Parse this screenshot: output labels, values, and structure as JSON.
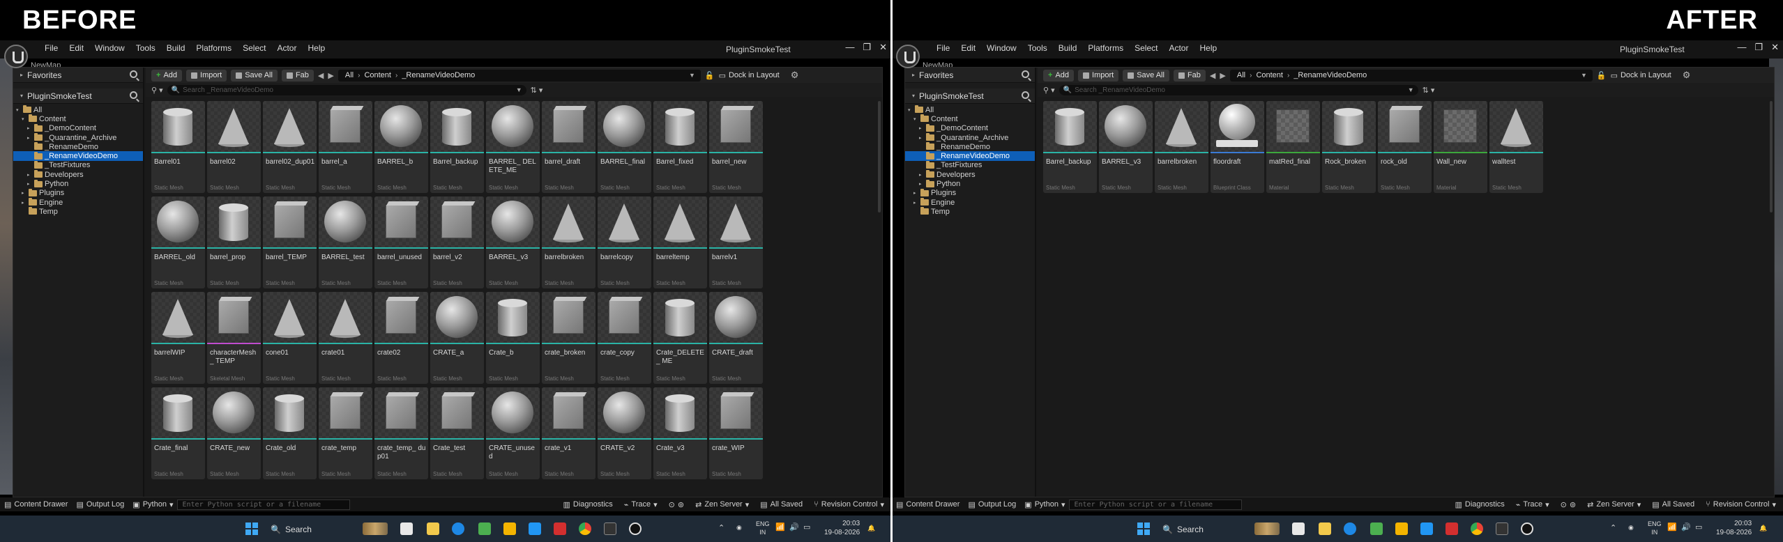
{
  "labels": {
    "before": "BEFORE",
    "after": "AFTER"
  },
  "app": {
    "title": "PluginSmokeTest",
    "menu": [
      "File",
      "Edit",
      "Window",
      "Tools",
      "Build",
      "Platforms",
      "Select",
      "Actor",
      "Help"
    ],
    "tab": "NewMap",
    "window_buttons": [
      "—",
      "❐",
      "✕"
    ]
  },
  "sidebar": {
    "favorites": "Favorites",
    "project": "PluginSmokeTest",
    "tree": [
      {
        "label": "All",
        "indent": 0,
        "arrow": "▾",
        "folder": true
      },
      {
        "label": "Content",
        "indent": 1,
        "arrow": "▾",
        "folder": true
      },
      {
        "label": "_DemoContent",
        "indent": 2,
        "arrow": "▸",
        "folder": true
      },
      {
        "label": "_Quarantine_Archive",
        "indent": 2,
        "arrow": "▸",
        "folder": true
      },
      {
        "label": "_RenameDemo",
        "indent": 2,
        "arrow": "",
        "folder": true
      },
      {
        "label": "_RenameVideoDemo",
        "indent": 2,
        "arrow": "",
        "folder": true,
        "selected": true
      },
      {
        "label": "_TestFixtures",
        "indent": 2,
        "arrow": "",
        "folder": true
      },
      {
        "label": "Developers",
        "indent": 2,
        "arrow": "▸",
        "folder": true
      },
      {
        "label": "Python",
        "indent": 2,
        "arrow": "▸",
        "folder": true
      },
      {
        "label": "Plugins",
        "indent": 1,
        "arrow": "▸",
        "folder": true
      },
      {
        "label": "Engine",
        "indent": 1,
        "arrow": "▸",
        "folder": true
      },
      {
        "label": "Temp",
        "indent": 1,
        "arrow": "",
        "folder": true
      }
    ]
  },
  "toolbar": {
    "add": "Add",
    "import": "Import",
    "save_all": "Save All",
    "fab": "Fab",
    "path": [
      "All",
      "Content",
      "_RenameVideoDemo"
    ],
    "dock": "Dock in Layout"
  },
  "search": {
    "placeholder": "Search _RenameVideoDemo"
  },
  "before_assets": [
    {
      "name": "Barrel01",
      "type": "Static Mesh",
      "shape": "cyl"
    },
    {
      "name": "barrel02",
      "type": "Static Mesh",
      "shape": "cone"
    },
    {
      "name": "barrel02_dup01",
      "type": "Static Mesh",
      "shape": "cone"
    },
    {
      "name": "barrel_a",
      "type": "Static Mesh",
      "shape": "cube"
    },
    {
      "name": "BARREL_b",
      "type": "Static Mesh",
      "shape": "sph"
    },
    {
      "name": "Barrel_backup",
      "type": "Static Mesh",
      "shape": "cyl"
    },
    {
      "name": "BARREL_ DELETE_ME",
      "type": "Static Mesh",
      "shape": "sph"
    },
    {
      "name": "barrel_draft",
      "type": "Static Mesh",
      "shape": "cube"
    },
    {
      "name": "BARREL_final",
      "type": "Static Mesh",
      "shape": "sph"
    },
    {
      "name": "Barrel_fixed",
      "type": "Static Mesh",
      "shape": "cyl"
    },
    {
      "name": "barrel_new",
      "type": "Static Mesh",
      "shape": "cube"
    },
    {
      "name": "BARREL_old",
      "type": "Static Mesh",
      "shape": "sph"
    },
    {
      "name": "barrel_prop",
      "type": "Static Mesh",
      "shape": "cyl"
    },
    {
      "name": "barrel_TEMP",
      "type": "Static Mesh",
      "shape": "cube"
    },
    {
      "name": "BARREL_test",
      "type": "Static Mesh",
      "shape": "sph"
    },
    {
      "name": "barrel_unused",
      "type": "Static Mesh",
      "shape": "cube"
    },
    {
      "name": "barrel_v2",
      "type": "Static Mesh",
      "shape": "cube"
    },
    {
      "name": "BARREL_v3",
      "type": "Static Mesh",
      "shape": "sph"
    },
    {
      "name": "barrelbroken",
      "type": "Static Mesh",
      "shape": "cone"
    },
    {
      "name": "barrelcopy",
      "type": "Static Mesh",
      "shape": "cone"
    },
    {
      "name": "barreltemp",
      "type": "Static Mesh",
      "shape": "cone"
    },
    {
      "name": "barrelv1",
      "type": "Static Mesh",
      "shape": "cone"
    },
    {
      "name": "barrelWIP",
      "type": "Static Mesh",
      "shape": "cone"
    },
    {
      "name": "characterMesh_ TEMP",
      "type": "Skeletal Mesh",
      "shape": "cube"
    },
    {
      "name": "cone01",
      "type": "Static Mesh",
      "shape": "cone"
    },
    {
      "name": "crate01",
      "type": "Static Mesh",
      "shape": "cone"
    },
    {
      "name": "crate02",
      "type": "Static Mesh",
      "shape": "cube"
    },
    {
      "name": "CRATE_a",
      "type": "Static Mesh",
      "shape": "sph"
    },
    {
      "name": "Crate_b",
      "type": "Static Mesh",
      "shape": "cyl"
    },
    {
      "name": "crate_broken",
      "type": "Static Mesh",
      "shape": "cube"
    },
    {
      "name": "crate_copy",
      "type": "Static Mesh",
      "shape": "cube"
    },
    {
      "name": "Crate_DELETE_ ME",
      "type": "Static Mesh",
      "shape": "cyl"
    },
    {
      "name": "CRATE_draft",
      "type": "Static Mesh",
      "shape": "sph"
    },
    {
      "name": "Crate_final",
      "type": "Static Mesh",
      "shape": "cyl"
    },
    {
      "name": "CRATE_new",
      "type": "Static Mesh",
      "shape": "sph"
    },
    {
      "name": "Crate_old",
      "type": "Static Mesh",
      "shape": "cyl"
    },
    {
      "name": "crate_temp",
      "type": "Static Mesh",
      "shape": "cube"
    },
    {
      "name": "crate_temp_ dup01",
      "type": "Static Mesh",
      "shape": "cube"
    },
    {
      "name": "Crate_test",
      "type": "Static Mesh",
      "shape": "cube"
    },
    {
      "name": "CRATE_unused",
      "type": "Static Mesh",
      "shape": "sph"
    },
    {
      "name": "crate_v1",
      "type": "Static Mesh",
      "shape": "cube"
    },
    {
      "name": "CRATE_v2",
      "type": "Static Mesh",
      "shape": "sph"
    },
    {
      "name": "Crate_v3",
      "type": "Static Mesh",
      "shape": "cyl"
    },
    {
      "name": "crate_WIP",
      "type": "Static Mesh",
      "shape": "cube"
    }
  ],
  "after_assets": [
    {
      "name": "Barrel_backup",
      "type": "Static Mesh",
      "shape": "cyl"
    },
    {
      "name": "BARREL_v3",
      "type": "Static Mesh",
      "shape": "sph"
    },
    {
      "name": "barrelbroken",
      "type": "Static Mesh",
      "shape": "cone"
    },
    {
      "name": "floordraft",
      "type": "Blueprint Class",
      "shape": "bp"
    },
    {
      "name": "matRed_final",
      "type": "Material",
      "shape": "plane"
    },
    {
      "name": "Rock_broken",
      "type": "Static Mesh",
      "shape": "cyl"
    },
    {
      "name": "rock_old",
      "type": "Static Mesh",
      "shape": "cube"
    },
    {
      "name": "Wall_new",
      "type": "Material",
      "shape": "plane"
    },
    {
      "name": "walltest",
      "type": "Static Mesh",
      "shape": "cone"
    }
  ],
  "statusbar": {
    "content_drawer": "Content Drawer",
    "output_log": "Output Log",
    "python": "Python",
    "cmd_placeholder": "Enter Python script or a filename",
    "diagnostics": "Diagnostics",
    "trace": "Trace",
    "zen": "Zen Server",
    "saved": "All Saved",
    "revision": "Revision Control"
  },
  "taskbar": {
    "search": "Search",
    "lang1": "ENG",
    "lang2": "IN",
    "time": "20:03",
    "date": "19-08-2026"
  }
}
